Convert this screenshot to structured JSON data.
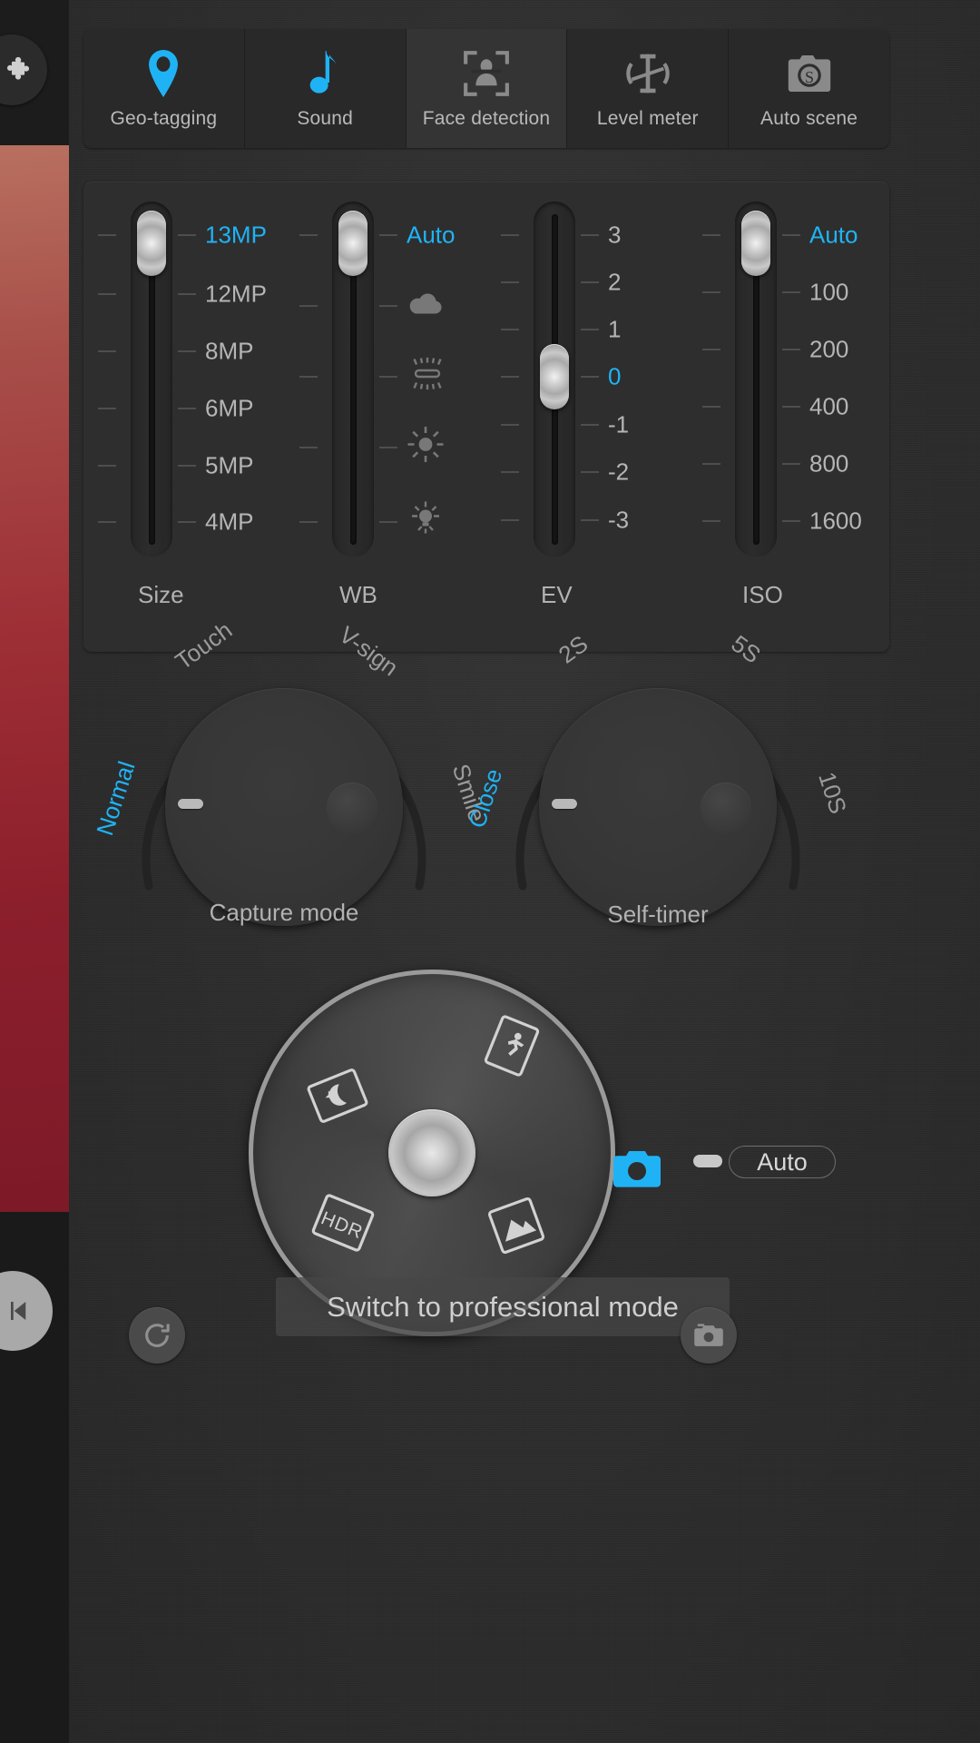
{
  "theme": {
    "accent": "#1fb3f5",
    "panel_bg": "#2e2e2e",
    "text": "#b5b5b5"
  },
  "left_rail": {
    "puzzle_icon": "puzzle-piece-icon",
    "prev_icon": "play-previous-icon",
    "preview_thumbnail": "photo-preview-strip"
  },
  "toolbar": {
    "items": [
      {
        "label": "Geo-tagging",
        "icon": "location-pin-icon",
        "active": false,
        "accent": true
      },
      {
        "label": "Sound",
        "icon": "music-note-icon",
        "active": false,
        "accent": true
      },
      {
        "label": "Face detection",
        "icon": "face-detect-icon",
        "active": true,
        "accent": false
      },
      {
        "label": "Level meter",
        "icon": "level-meter-icon",
        "active": false,
        "accent": false
      },
      {
        "label": "Auto scene",
        "icon": "camera-scene-icon",
        "active": false,
        "accent": false
      }
    ]
  },
  "sliders": [
    {
      "name": "Size",
      "caption": "Size",
      "selected": "13MP",
      "thumb_index": 0,
      "options": [
        {
          "label": "13MP",
          "selected": true
        },
        {
          "label": "12MP",
          "selected": false
        },
        {
          "label": "8MP",
          "selected": false
        },
        {
          "label": "6MP",
          "selected": false
        },
        {
          "label": "5MP",
          "selected": false
        },
        {
          "label": "4MP",
          "selected": false
        }
      ]
    },
    {
      "name": "WB",
      "caption": "WB",
      "selected": "Auto",
      "thumb_index": 0,
      "options": [
        {
          "label": "Auto",
          "selected": true,
          "icon": null
        },
        {
          "label": "",
          "selected": false,
          "icon": "cloud-icon"
        },
        {
          "label": "",
          "selected": false,
          "icon": "fluorescent-icon"
        },
        {
          "label": "",
          "selected": false,
          "icon": "sun-icon"
        },
        {
          "label": "",
          "selected": false,
          "icon": "incandescent-icon"
        }
      ]
    },
    {
      "name": "EV",
      "caption": "EV",
      "selected": "0",
      "thumb_index": 3,
      "options": [
        {
          "label": "3",
          "selected": false
        },
        {
          "label": "2",
          "selected": false
        },
        {
          "label": "1",
          "selected": false
        },
        {
          "label": "0",
          "selected": true
        },
        {
          "label": "-1",
          "selected": false
        },
        {
          "label": "-2",
          "selected": false
        },
        {
          "label": "-3",
          "selected": false
        }
      ]
    },
    {
      "name": "ISO",
      "caption": "ISO",
      "selected": "Auto",
      "thumb_index": 0,
      "options": [
        {
          "label": "Auto",
          "selected": true
        },
        {
          "label": "100",
          "selected": false
        },
        {
          "label": "200",
          "selected": false
        },
        {
          "label": "400",
          "selected": false
        },
        {
          "label": "800",
          "selected": false
        },
        {
          "label": "1600",
          "selected": false
        }
      ]
    }
  ],
  "dials": [
    {
      "caption": "Capture mode",
      "selected": "Normal",
      "labels": [
        {
          "text": "Normal",
          "selected": true
        },
        {
          "text": "Touch",
          "selected": false
        },
        {
          "text": "V-sign",
          "selected": false
        },
        {
          "text": "Smile",
          "selected": false
        }
      ]
    },
    {
      "caption": "Self-timer",
      "selected": "Close",
      "labels": [
        {
          "text": "Close",
          "selected": true
        },
        {
          "text": "2S",
          "selected": false
        },
        {
          "text": "5S",
          "selected": false
        },
        {
          "text": "10S",
          "selected": false
        }
      ]
    }
  ],
  "scene_wheel": {
    "hub_icon": "rotary-hub-icon",
    "icons": [
      {
        "name": "sports-action-icon",
        "angle": 45
      },
      {
        "name": "night-scene-icon",
        "angle": 315
      },
      {
        "name": "hdr-icon",
        "angle": 225
      },
      {
        "name": "landscape-icon",
        "angle": 135
      }
    ]
  },
  "mode_row": {
    "camera_icon": "camera-icon",
    "mode_label": "Auto"
  },
  "toast": {
    "message": "Switch to professional mode"
  },
  "footer": {
    "reset_icon": "reset-icon",
    "camera_switch_icon": "switch-camera-icon"
  }
}
